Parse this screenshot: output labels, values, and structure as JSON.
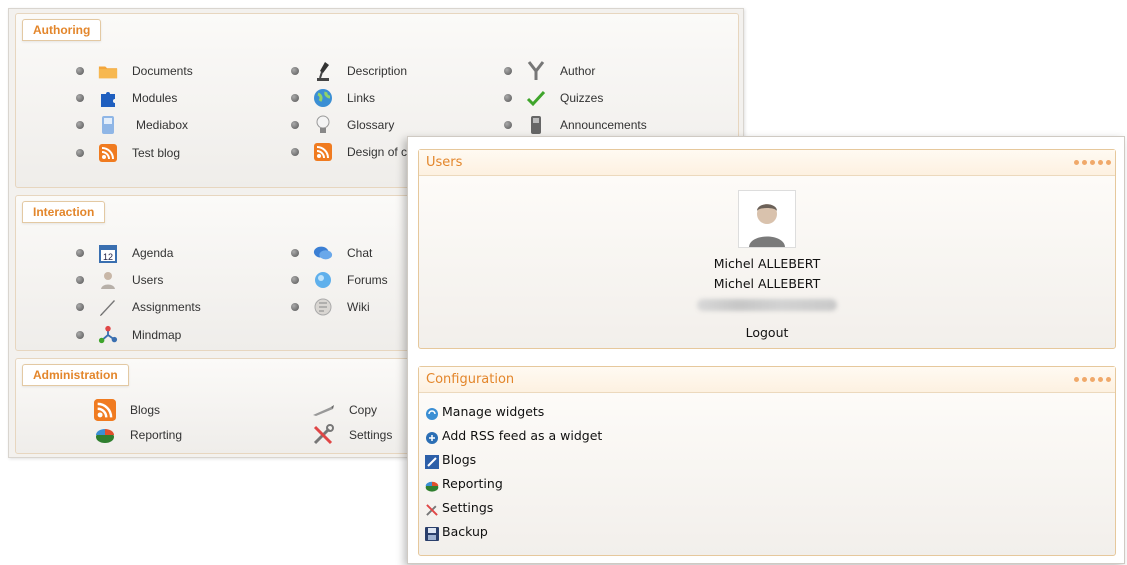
{
  "left_window": {
    "authoring": {
      "title": "Authoring",
      "tools": [
        {
          "label": "Documents",
          "icon": "folder-icon"
        },
        {
          "label": "Description",
          "icon": "microscope-icon"
        },
        {
          "label": "Author",
          "icon": "author-icon"
        },
        {
          "label": "Modules",
          "icon": "puzzle-icon"
        },
        {
          "label": "Links",
          "icon": "globe-icon"
        },
        {
          "label": "Quizzes",
          "icon": "checkmark-icon"
        },
        {
          "label": "Mediabox",
          "icon": "mediabox-icon"
        },
        {
          "label": "Glossary",
          "icon": "lightbulb-icon"
        },
        {
          "label": "Announcements",
          "icon": "phone-icon"
        },
        {
          "label": "Test blog",
          "icon": "rss-icon"
        },
        {
          "label": "Design of center",
          "icon": "rss-icon"
        }
      ]
    },
    "interaction": {
      "title": "Interaction",
      "tools": [
        {
          "label": "Agenda",
          "icon": "calendar-icon",
          "day": "12"
        },
        {
          "label": "Chat",
          "icon": "chat-icon"
        },
        {
          "label": "Users",
          "icon": "user-icon"
        },
        {
          "label": "Forums",
          "icon": "forum-icon"
        },
        {
          "label": "Assignments",
          "icon": "pen-icon"
        },
        {
          "label": "Wiki",
          "icon": "wiki-icon"
        },
        {
          "label": "Mindmap",
          "icon": "mindmap-icon"
        }
      ]
    },
    "administration": {
      "title": "Administration",
      "tools": [
        {
          "label": "Blogs",
          "icon": "rss-icon"
        },
        {
          "label": "Copy",
          "icon": "copy-icon"
        },
        {
          "label": "Reporting",
          "icon": "pie-chart-icon"
        },
        {
          "label": "Settings",
          "icon": "tools-icon"
        }
      ]
    }
  },
  "right_window": {
    "users_panel": {
      "title": "Users",
      "firstname_line": "Michel ALLEBERT",
      "fullname_line": "Michel ALLEBERT",
      "logout_label": "Logout"
    },
    "configuration_panel": {
      "title": "Configuration",
      "items": [
        {
          "label": "Manage widgets",
          "icon": "refresh-icon"
        },
        {
          "label": "Add RSS feed as a widget",
          "icon": "rss-add-icon"
        },
        {
          "label": "Blogs",
          "icon": "blog-icon"
        },
        {
          "label": "Reporting",
          "icon": "pie-chart-icon"
        },
        {
          "label": "Settings",
          "icon": "tools-icon"
        },
        {
          "label": "Backup",
          "icon": "floppy-icon"
        }
      ]
    }
  },
  "colors": {
    "accent_orange": "#e3862b",
    "panel_border": "#e6c89c"
  }
}
